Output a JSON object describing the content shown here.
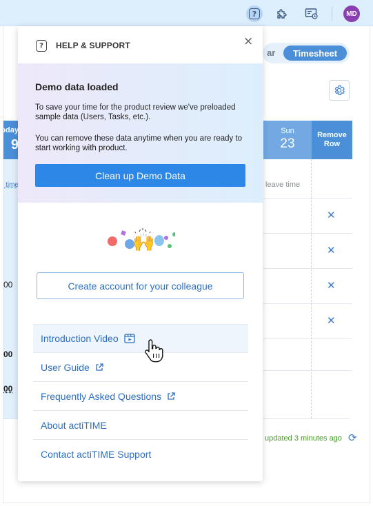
{
  "topbar": {
    "help_icon_glyph": "?",
    "avatar_initials": "MD",
    "avatar_color": "#8a3fb0"
  },
  "background": {
    "view_toggle": {
      "partial_label": "ar",
      "active_label": "Timesheet"
    },
    "today_header": {
      "day": "oday",
      "date": "9"
    },
    "sun_header": {
      "day": "Sun",
      "date": "23"
    },
    "remove_row_header": "Remove Row",
    "leave_time_left": "e time",
    "leave_time_right": "leave time",
    "left_numbers": [
      "00",
      "00",
      "00"
    ],
    "updated_text": "updated 3 minutes ago",
    "remove_glyph": "✕",
    "refresh_glyph": "⟳"
  },
  "panel": {
    "header_icon_glyph": "?",
    "title": "HELP & SUPPORT",
    "close_glyph": "×",
    "demo": {
      "heading": "Demo data loaded",
      "paragraph1": "To save your time for the product review we've preloaded sample data (Users, Tasks, etc.).",
      "paragraph2": "You can remove these data anytime when you are ready to start working with product.",
      "cleanup_button": "Clean up Demo Data"
    },
    "illustration_emoji": "🙌",
    "create_account_button": "Create account for your colleague",
    "links": [
      {
        "label": "Introduction Video",
        "icon": "video-icon"
      },
      {
        "label": "User Guide",
        "icon": "external-link-icon"
      },
      {
        "label": "Frequently Asked Questions",
        "icon": "external-link-icon"
      },
      {
        "label": "About actiTIME",
        "icon": ""
      },
      {
        "label": "Contact actiTIME Support",
        "icon": ""
      }
    ]
  },
  "colors": {
    "accent": "#2d87e6",
    "link": "#2d6fc0",
    "header_blue": "#4a8fd8",
    "updated_green": "#4a9a2a"
  }
}
